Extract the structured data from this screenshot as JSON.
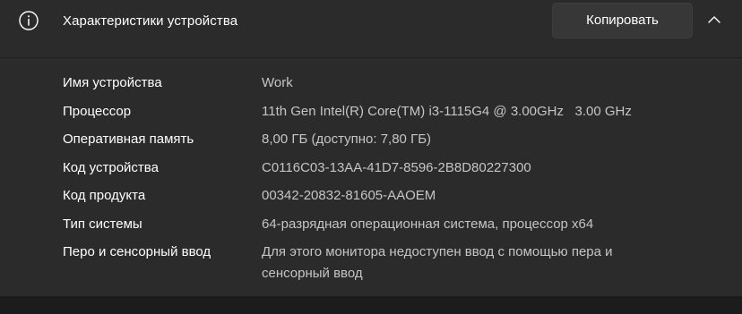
{
  "header": {
    "title": "Характеристики устройства",
    "copy_label": "Копировать",
    "info_icon": "info-icon",
    "collapse_icon": "chevron-up-icon"
  },
  "specs": [
    {
      "label": "Имя устройства",
      "value": "Work"
    },
    {
      "label": "Процессор",
      "value": "11th Gen Intel(R) Core(TM) i3-1115G4 @ 3.00GHz   3.00 GHz"
    },
    {
      "label": "Оперативная память",
      "value": "8,00 ГБ (доступно: 7,80 ГБ)"
    },
    {
      "label": "Код устройства",
      "value": "C0116C03-13AA-41D7-8596-2B8D80227300"
    },
    {
      "label": "Код продукта",
      "value": "00342-20832-81605-AAOEM"
    },
    {
      "label": "Тип системы",
      "value": "64-разрядная операционная система, процессор x64"
    },
    {
      "label": "Перо и сенсорный ввод",
      "value": "Для этого монитора недоступен ввод с помощью пера и сенсорный ввод"
    }
  ],
  "colors": {
    "background": "#1c1c1c",
    "card": "#2b2b2b",
    "button": "#373737",
    "label_text": "#ffffff",
    "value_text": "#c5c5c5"
  }
}
